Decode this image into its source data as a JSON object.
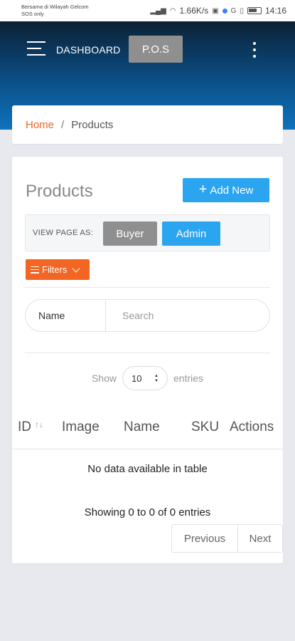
{
  "status_bar": {
    "carrier": "Bersama di Wilayah Gelcom",
    "carrier_sub": "SOS only",
    "speed": "1.66K/s",
    "time": "14:16"
  },
  "header": {
    "menu_label": "DASHBOARD",
    "pos_label": "P.O.S"
  },
  "breadcrumb": {
    "home": "Home",
    "separator": "/",
    "current": "Products"
  },
  "products": {
    "title": "Products",
    "add_plus": "+",
    "add_label": "Add New",
    "view_as_label": "VIEW PAGE AS:",
    "buyer_label": "Buyer",
    "admin_label": "Admin",
    "filters_label": "Filters"
  },
  "search": {
    "field_label": "Name",
    "placeholder": "Search"
  },
  "length": {
    "show": "Show",
    "value": "10",
    "entries": "entries"
  },
  "table": {
    "columns": [
      "ID",
      "Image",
      "Name",
      "SKU",
      "Actions"
    ],
    "sort_glyph": "↑↓",
    "empty": "No data available in table",
    "info": "Showing 0 to 0 of 0 entries"
  },
  "pagination": {
    "previous": "Previous",
    "next": "Next"
  },
  "colors": {
    "accent_orange": "#f26522",
    "accent_blue": "#2ba5f0",
    "neutral_gray": "#8f8f8f"
  }
}
